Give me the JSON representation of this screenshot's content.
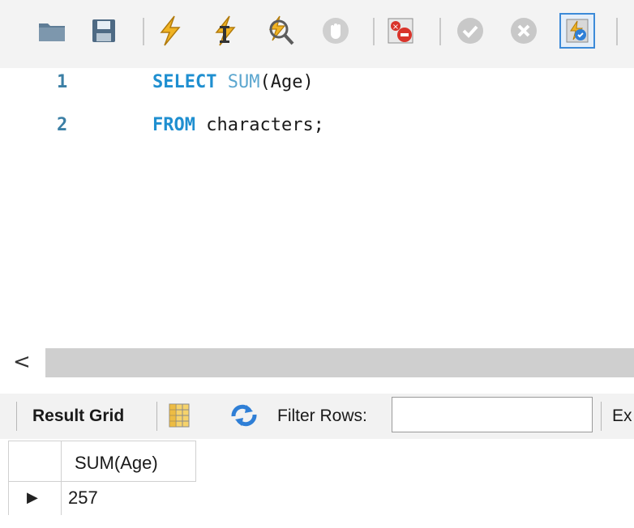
{
  "toolbar": {
    "buttons": [
      {
        "name": "open-folder",
        "icon": "folder-icon"
      },
      {
        "name": "save",
        "icon": "save-icon"
      },
      {
        "name": "execute",
        "icon": "lightning-icon"
      },
      {
        "name": "execute-current",
        "icon": "lightning-cursor-icon"
      },
      {
        "name": "explain",
        "icon": "magnifier-icon"
      },
      {
        "name": "stop",
        "icon": "stop-hand-icon"
      },
      {
        "name": "toggle-continue-on-error",
        "icon": "error-stop-icon"
      },
      {
        "name": "commit",
        "icon": "check-icon"
      },
      {
        "name": "rollback",
        "icon": "x-circle-icon"
      },
      {
        "name": "toggle-autocommit",
        "icon": "autocommit-icon"
      }
    ],
    "accent_color": "#3c8ad8"
  },
  "editor": {
    "lines": [
      {
        "number": "1",
        "keyword": "SELECT",
        "function": "SUM",
        "rest": "(Age)"
      },
      {
        "number": "2",
        "keyword": "FROM",
        "function": "",
        "rest": "characters;"
      }
    ],
    "keyword_color": "#1f8fd0",
    "function_color": "#5ba6cf"
  },
  "scrollbar": {
    "left_arrow": "<"
  },
  "result_bar": {
    "result_grid_label": "Result Grid",
    "filter_label": "Filter Rows:",
    "filter_value": "",
    "truncated_label": "Ex"
  },
  "grid": {
    "columns": [
      "SUM(Age)"
    ],
    "rows": [
      [
        "257"
      ]
    ],
    "row_indicator": "▶"
  }
}
